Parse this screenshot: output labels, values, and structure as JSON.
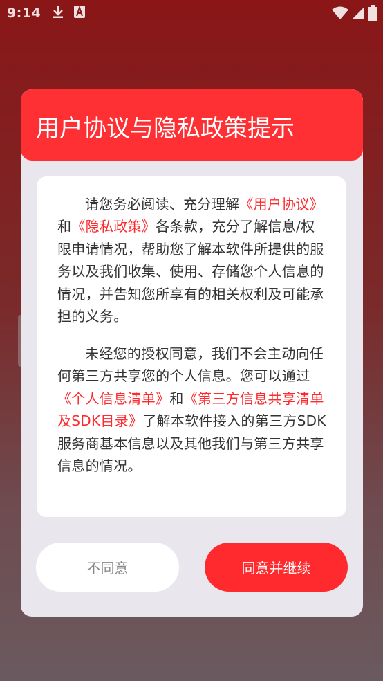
{
  "status_bar": {
    "time": "9:14",
    "icons_left": [
      "download-icon",
      "a-icon"
    ],
    "icons_right": [
      "wifi-icon",
      "signal-icon",
      "battery-icon"
    ]
  },
  "dialog": {
    "title": "用户协议与隐私政策提示",
    "para1": {
      "text_a": "请您务必阅读、充分理解",
      "link_user_agreement": "《用户协议》",
      "text_b": "和",
      "link_privacy_policy": "《隐私政策》",
      "text_c": "各条款，充分了解信息/权限申请情况，帮助您了解本软件所提供的服务以及我们收集、使用、存储您个人信息的情况，并告知您所享有的相关权利及可能承担的义务。"
    },
    "para2": {
      "text_a": "未经您的授权同意，我们不会主动向任何第三方共享您的个人信息。您可以通过",
      "link_personal_info_list": "《个人信息清单》",
      "text_b": "和",
      "link_third_party_list": "《第三方信息共享清单及SDK目录》",
      "text_c": "了解本软件接入的第三方SDK服务商基本信息以及其他我们与第三方共享信息的情况。"
    },
    "decline_label": "不同意",
    "agree_label": "同意并继续"
  },
  "colors": {
    "accent": "#ff2a2e",
    "header": "#ff3034",
    "dialog_bg": "#e9e6ee"
  }
}
